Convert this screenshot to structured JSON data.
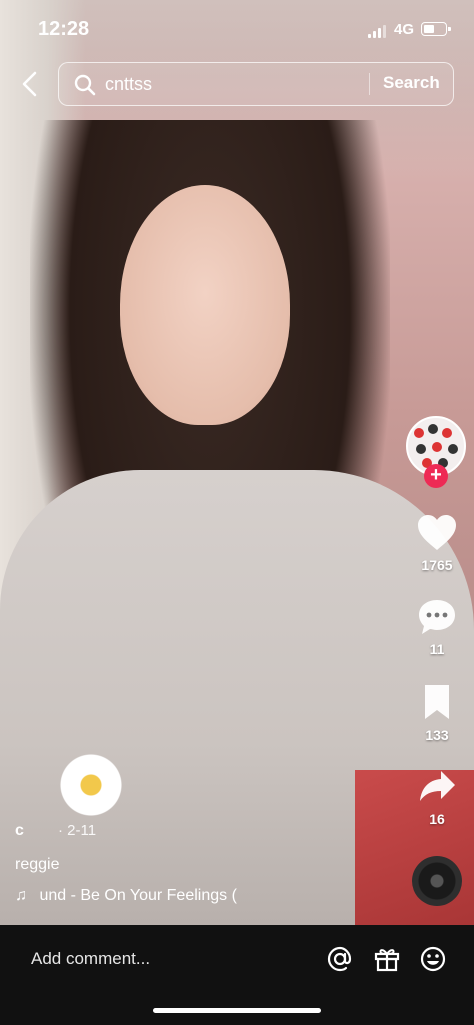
{
  "status_bar": {
    "time": "12:28",
    "network": "4G"
  },
  "search": {
    "value": "cnttss",
    "button_label": "Search"
  },
  "actions": {
    "likes": "1765",
    "comments": "11",
    "saves": "133",
    "shares": "16"
  },
  "post": {
    "author": "c",
    "date": "· 2-11",
    "caption": "reggie",
    "music": "und - Be On Your Feelings ("
  },
  "bottom_bar": {
    "comment_placeholder": "Add comment..."
  },
  "colors": {
    "follow_badge": "#ee2a55",
    "bottom_bar": "#111111"
  },
  "icons": [
    "back-icon",
    "search-icon",
    "heart-icon",
    "comment-icon",
    "bookmark-icon",
    "share-icon",
    "music-note-icon",
    "mention-icon",
    "gift-icon",
    "emoji-icon"
  ]
}
